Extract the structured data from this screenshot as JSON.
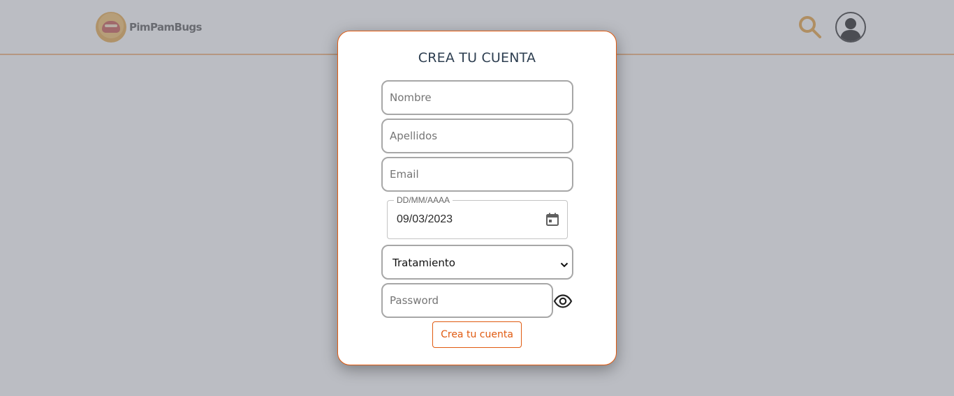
{
  "header": {
    "brand": "PimPamBugs",
    "logo_icon": "bug-logo-icon",
    "search_icon": "search-icon",
    "avatar_icon": "user-avatar-icon",
    "accent_color": "#f3b27a"
  },
  "modal": {
    "title": "CREA TU CUENTA",
    "fields": {
      "nombre_placeholder": "Nombre",
      "apellidos_placeholder": "Apellidos",
      "email_placeholder": "Email",
      "password_placeholder": "Password"
    },
    "date": {
      "label": "DD/MM/AAAA",
      "value": "09/03/2023",
      "icon": "calendar-icon"
    },
    "select": {
      "value": "Tratamiento",
      "icon": "chevron-down-icon"
    },
    "password_toggle_icon": "eye-icon",
    "submit_label": "Crea tu cuenta",
    "border_color": "#e05a10",
    "title_color": "#2d3e50"
  },
  "overlay_color": "#bcbdc2"
}
